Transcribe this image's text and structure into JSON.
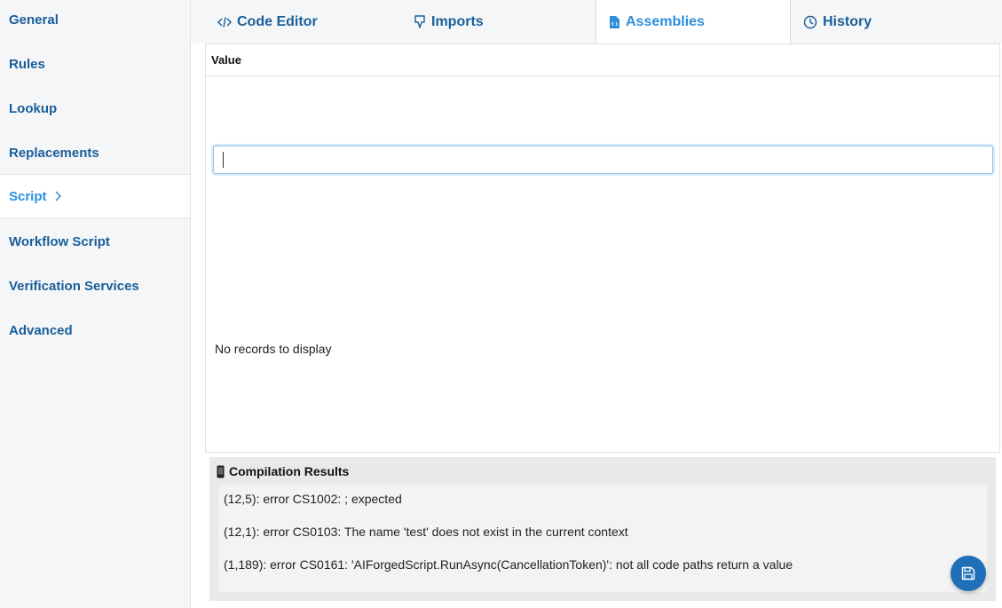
{
  "sidebar": {
    "items": [
      {
        "label": "General"
      },
      {
        "label": "Rules"
      },
      {
        "label": "Lookup"
      },
      {
        "label": "Replacements"
      },
      {
        "label": "Script",
        "active": true
      },
      {
        "label": "Workflow Script"
      },
      {
        "label": "Verification Services"
      },
      {
        "label": "Advanced"
      }
    ]
  },
  "tabs": [
    {
      "label": "Code Editor",
      "icon": "code-icon"
    },
    {
      "label": "Imports",
      "icon": "download-icon"
    },
    {
      "label": "Assemblies",
      "icon": "file-code-icon",
      "active": true
    },
    {
      "label": "History",
      "icon": "clock-icon"
    }
  ],
  "grid": {
    "column_header": "Value",
    "filter_value": "",
    "empty_message": "No records to display"
  },
  "compilation": {
    "title": "Compilation Results",
    "icon": "device-icon",
    "errors": [
      "(12,5): error CS1002: ; expected",
      "(12,1): error CS0103: The name 'test' does not exist in the current context",
      "(1,189): error CS0161: 'AIForgedScript.RunAsync(CancellationToken)': not all code paths return a value"
    ]
  },
  "save_button": {
    "icon": "save-icon"
  },
  "colors": {
    "accent": "#2d8fdc",
    "nav_text": "#1a5e9a",
    "save_bg": "#1f6fb8"
  }
}
